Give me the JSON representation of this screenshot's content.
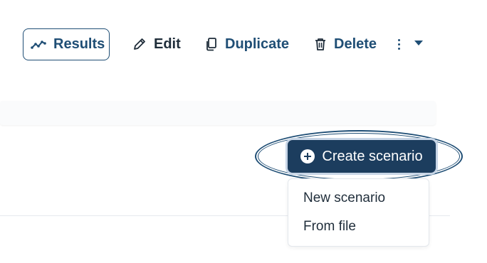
{
  "toolbar": {
    "results_label": "Results",
    "edit_label": "Edit",
    "duplicate_label": "Duplicate",
    "delete_label": "Delete"
  },
  "scenario": {
    "create_label": "Create scenario",
    "menu": [
      {
        "label": "New scenario"
      },
      {
        "label": "From file"
      }
    ]
  },
  "colors": {
    "primary": "#1f4e75",
    "button_bg": "#1c3d5e",
    "text_dark": "#1f2d3a"
  },
  "icons": {
    "results": "chart-line-icon",
    "edit": "pencil-icon",
    "duplicate": "copy-icon",
    "delete": "trash-icon",
    "more": "kebab-icon",
    "dropdown": "caret-down-icon",
    "create": "plus-circle-icon"
  }
}
